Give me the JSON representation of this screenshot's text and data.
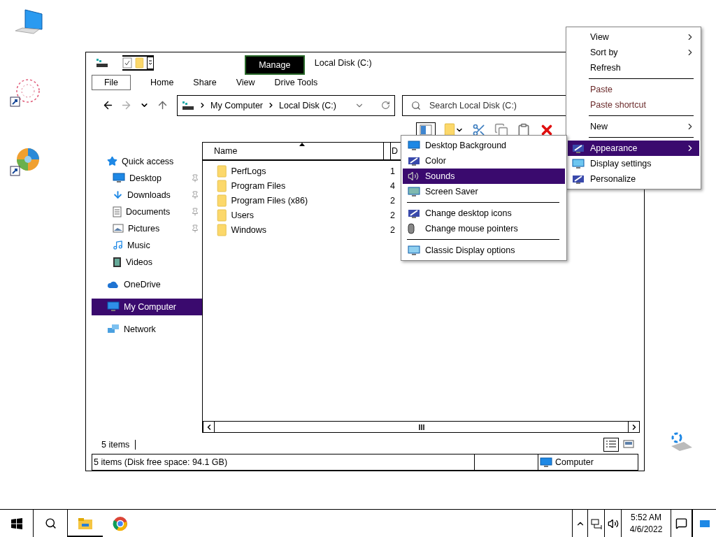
{
  "window": {
    "title": "Local Disk (C:)",
    "context_tab": "Manage",
    "ribbon_tabs": [
      {
        "label": "File",
        "kind": "file"
      },
      {
        "label": "Home",
        "kind": "tab"
      },
      {
        "label": "Share",
        "kind": "tab"
      },
      {
        "label": "View",
        "kind": "tab"
      },
      {
        "label": "Drive Tools",
        "kind": "tab"
      }
    ],
    "address": {
      "crumbs": [
        "My Computer",
        "Local Disk (C:)"
      ]
    },
    "search": {
      "placeholder": "Search Local Disk (C:)"
    },
    "nav": [
      {
        "label": "Quick access",
        "selected": false,
        "children": [
          {
            "label": "Desktop",
            "selected": false,
            "pinned": true
          },
          {
            "label": "Downloads",
            "selected": false,
            "pinned": true
          },
          {
            "label": "Documents",
            "selected": false,
            "pinned": true
          },
          {
            "label": "Pictures",
            "selected": false,
            "pinned": true
          },
          {
            "label": "Music",
            "selected": false,
            "pinned": false
          },
          {
            "label": "Videos",
            "selected": false,
            "pinned": false
          }
        ]
      },
      {
        "label": "OneDrive",
        "selected": false
      },
      {
        "label": "My Computer",
        "selected": true
      },
      {
        "label": "Network",
        "selected": false
      }
    ],
    "table": {
      "columns": [
        "Name",
        "D"
      ],
      "rows": [
        {
          "name": "PerfLogs",
          "column_2": "1"
        },
        {
          "name": "Program Files",
          "column_2": "4"
        },
        {
          "name": "Program Files (x86)",
          "column_2": "2"
        },
        {
          "name": "Users",
          "column_2": "2"
        },
        {
          "name": "Windows",
          "column_2": "2"
        }
      ]
    },
    "item_count": "5 items",
    "status_bar": {
      "info": "5 items (Disk free space: 94.1 GB)",
      "location": "Computer"
    }
  },
  "context_menu": [
    {
      "kind": "item",
      "label": "View",
      "submenu": true,
      "disabled": false,
      "selected": false
    },
    {
      "kind": "item",
      "label": "Sort by",
      "submenu": true,
      "disabled": false,
      "selected": false
    },
    {
      "kind": "item",
      "label": "Refresh",
      "submenu": false,
      "disabled": false,
      "selected": false
    },
    {
      "kind": "separator"
    },
    {
      "kind": "item",
      "label": "Paste",
      "submenu": false,
      "disabled": true,
      "selected": false
    },
    {
      "kind": "item",
      "label": "Paste shortcut",
      "submenu": false,
      "disabled": true,
      "selected": false
    },
    {
      "kind": "separator"
    },
    {
      "kind": "item",
      "label": "New",
      "submenu": true,
      "disabled": false,
      "selected": false
    },
    {
      "kind": "separator"
    },
    {
      "kind": "item",
      "label": "Appearance",
      "submenu": true,
      "disabled": false,
      "selected": true,
      "icon": true
    },
    {
      "kind": "item",
      "label": "Display settings",
      "submenu": false,
      "disabled": false,
      "selected": false,
      "icon": true
    },
    {
      "kind": "item",
      "label": "Personalize",
      "submenu": false,
      "disabled": false,
      "selected": false,
      "icon": true
    }
  ],
  "submenu": [
    {
      "kind": "item",
      "label": "Desktop Background",
      "selected": false
    },
    {
      "kind": "item",
      "label": "Color",
      "selected": false
    },
    {
      "kind": "item",
      "label": "Sounds",
      "selected": true
    },
    {
      "kind": "item",
      "label": "Screen Saver",
      "selected": false
    },
    {
      "kind": "separator"
    },
    {
      "kind": "item",
      "label": "Change desktop icons",
      "selected": false
    },
    {
      "kind": "item",
      "label": "Change mouse pointers",
      "selected": false
    },
    {
      "kind": "separator"
    },
    {
      "kind": "item",
      "label": "Classic Display options",
      "selected": false
    }
  ],
  "taskbar": {
    "apps": [
      {
        "selected": true
      },
      {
        "selected": false
      }
    ],
    "time": "5:52 AM",
    "date": "4/6/2022"
  }
}
